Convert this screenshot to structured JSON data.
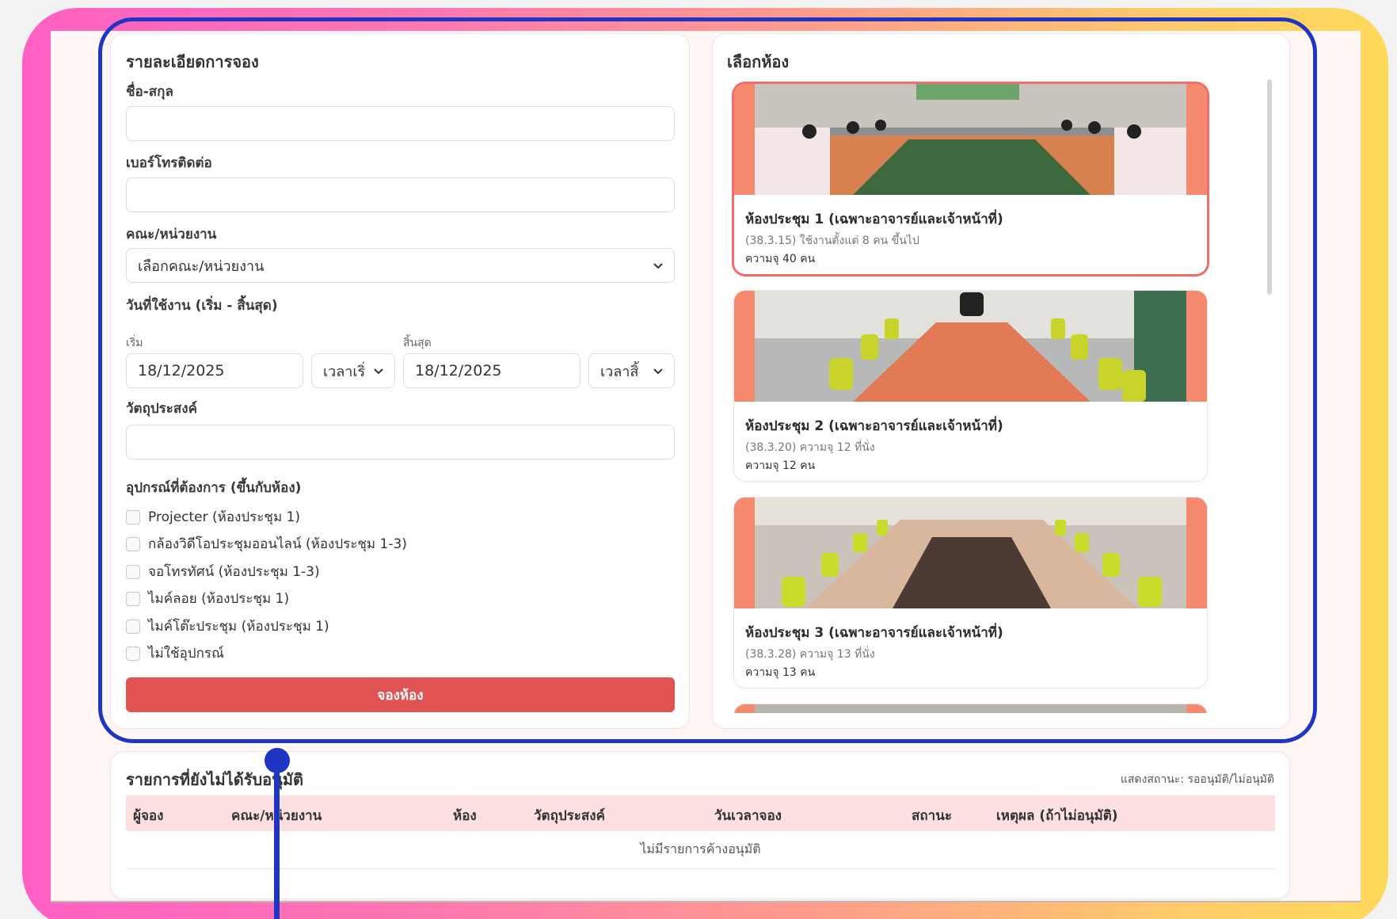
{
  "booking_form": {
    "title": "รายละเอียดการจอง",
    "name_label": "ชื่อ-สกุล",
    "name_value": "",
    "phone_label": "เบอร์โทรติดต่อ",
    "phone_value": "",
    "department_label": "คณะ/หน่วยงาน",
    "department_selected": "เลือกคณะ/หน่วยงาน",
    "date_range_label": "วันที่ใช้งาน (เริ่ม - สิ้นสุด)",
    "start_label": "เริ่ม",
    "end_label": "สิ้นสุด",
    "start_date": "18/12/2025",
    "start_time": "เวลาเริ่",
    "end_date": "18/12/2025",
    "end_time": "เวลาสิ้",
    "purpose_label": "วัตถุประสงค์",
    "purpose_value": "",
    "equipment_label": "อุปกรณ์ที่ต้องการ (ขึ้นกับห้อง)",
    "equipment": [
      {
        "label": "Projecter (ห้องประชุม 1)",
        "checked": false
      },
      {
        "label": "กล้องวิดีโอประชุมออนไลน์ (ห้องประชุม 1-3)",
        "checked": false
      },
      {
        "label": "จอโทรทัศน์ (ห้องประชุม 1-3)",
        "checked": false
      },
      {
        "label": "ไมค์ลอย (ห้องประชุม 1)",
        "checked": false
      },
      {
        "label": "ไมค์โต๊ะประชุม (ห้องประชุม 1)",
        "checked": false
      },
      {
        "label": "ไม่ใช้อุปกรณ์",
        "checked": false
      }
    ],
    "submit_label": "จองห้อง"
  },
  "room_select": {
    "title": "เลือกห้อง",
    "rooms": [
      {
        "name": "ห้องประชุม 1 (เฉพาะอาจารย์และเจ้าหน้าที่)",
        "desc": "(38.3.15) ใช้งานตั้งแต่ 8 คน ขึ้นไป",
        "capacity": "ความจุ 40 คน",
        "selected": true
      },
      {
        "name": "ห้องประชุม 2 (เฉพาะอาจารย์และเจ้าหน้าที่)",
        "desc": "(38.3.20) ความจุ 12 ที่นั่ง",
        "capacity": "ความจุ 12 คน",
        "selected": false
      },
      {
        "name": "ห้องประชุม 3 (เฉพาะอาจารย์และเจ้าหน้าที่)",
        "desc": "(38.3.28) ความจุ 13 ที่นั่ง",
        "capacity": "ความจุ 13 คน",
        "selected": false
      }
    ]
  },
  "pending": {
    "title": "รายการที่ยังไม่ได้รับอนุมัติ",
    "status_note": "แสดงสถานะ: รออนุมัติ/ไม่อนุมัติ",
    "columns": [
      "ผู้จอง",
      "คณะ/หน่วยงาน",
      "ห้อง",
      "วัตถุประสงค์",
      "วันเวลาจอง",
      "สถานะ",
      "เหตุผล (ถ้าไม่อนุมัติ)"
    ],
    "empty_text": "ไม่มีรายการค้างอนุมัติ"
  },
  "colors": {
    "accent_red": "#e15252",
    "highlight_blue": "#1f36c4",
    "header_pink": "#fde0e0"
  }
}
